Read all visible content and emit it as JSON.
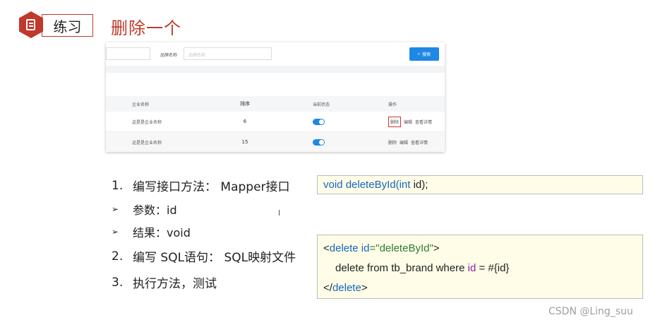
{
  "header": {
    "tag_label": "练习",
    "title": "删除一个"
  },
  "screenshot": {
    "brand_label": "品牌名称",
    "brand_placeholder": "品牌名称",
    "search_label": "搜索",
    "columns": [
      "企业名称",
      "排序",
      "当前状态",
      "操作"
    ],
    "rows": [
      {
        "name": "这是是企业名称",
        "sort": "6",
        "status_on": true,
        "ops": [
          "删除",
          "编辑",
          "查看详情"
        ]
      },
      {
        "name": "这是是企业名称",
        "sort": "15",
        "status_on": true,
        "ops": [
          "删除",
          "编辑",
          "查看详情"
        ]
      }
    ],
    "accent": "#1e88e5",
    "highlight": "#d32f2f"
  },
  "steps": [
    {
      "num": "1.",
      "text": "编写接口方法： Mapper接口"
    },
    {
      "bullet": "➢",
      "text": "参数：id"
    },
    {
      "bullet": "➢",
      "text": "结果：void"
    },
    {
      "num": "2.",
      "text": "编写 SQL语句： SQL映射文件"
    },
    {
      "num": "3.",
      "text": "执行方法，测试"
    }
  ],
  "code1": {
    "t1": "void",
    "t2": " deleteById(",
    "t3": "int",
    "t4": " id);"
  },
  "code2": {
    "l1a": "<",
    "l1b": "delete",
    "l1c": " id",
    "l1d": "=\"deleteById\"",
    "l1e": ">",
    "l2a": "delete from tb_brand where ",
    "l2b": "id",
    "l2c": " = #{id}",
    "l3a": "</",
    "l3b": "delete",
    "l3c": ">"
  },
  "watermark": "CSDN @Ling_suu",
  "colors": {
    "brand_red": "#c0392b",
    "code_bg": "#fffde7"
  }
}
